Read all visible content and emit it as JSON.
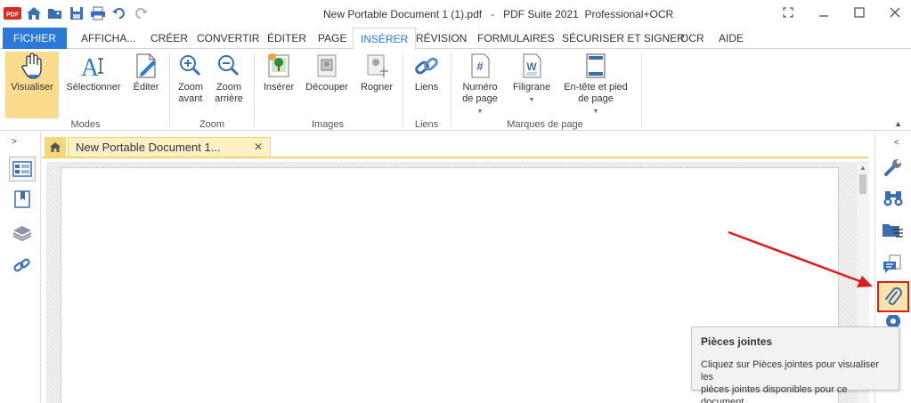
{
  "window": {
    "title": "New Portable Document 1 (1).pdf   -   PDF Suite 2021  Professional+OCR"
  },
  "quick_access": {
    "icons": [
      "pdf-logo-icon",
      "home-icon",
      "open-folder-icon",
      "save-icon",
      "print-icon",
      "undo-icon",
      "redo-icon"
    ]
  },
  "tabs": [
    {
      "label": "FICHIER"
    },
    {
      "label": "AFFICHA..."
    },
    {
      "label": "CRÉER"
    },
    {
      "label": "CONVERTIR"
    },
    {
      "label": "ÉDITER"
    },
    {
      "label": "PAGE"
    },
    {
      "label": "INSÉRER"
    },
    {
      "label": "RÉVISION"
    },
    {
      "label": "FORMULAIRES"
    },
    {
      "label": "SÉCURISER ET SIGNER"
    },
    {
      "label": "OCR"
    },
    {
      "label": "AIDE"
    }
  ],
  "ribbon": {
    "modes": {
      "label": "Modes",
      "visualiser": "Visualiser",
      "selectionner": "Sélectionner",
      "editer": "Éditer"
    },
    "zoom": {
      "label": "Zoom",
      "zoom_in_1": "Zoom",
      "zoom_in_2": "avant",
      "zoom_out_1": "Zoom",
      "zoom_out_2": "arrière"
    },
    "images": {
      "label": "Images",
      "inserer": "Insérer",
      "decouper": "Découper",
      "rogner": "Rogner"
    },
    "liens": {
      "label": "Liens",
      "liens": "Liens"
    },
    "marques": {
      "label": "Marques de page",
      "numero_1": "Numéro",
      "numero_2": "de page",
      "filigrane": "Filigrane",
      "entete_1": "En-tête et pied",
      "entete_2": "de page"
    }
  },
  "document": {
    "tab_label": "New Portable Document 1...",
    "close_glyph": "✕"
  },
  "tooltip": {
    "title": "Pièces jointes",
    "body_1": "Cliquez sur Pièces jointes pour visualiser les",
    "body_2": "pièces jointes disponibles pour ce document."
  },
  "colors": {
    "accent": "#2b79d8",
    "highlight": "#fbdc8e",
    "annotation": "#e01b1b"
  }
}
